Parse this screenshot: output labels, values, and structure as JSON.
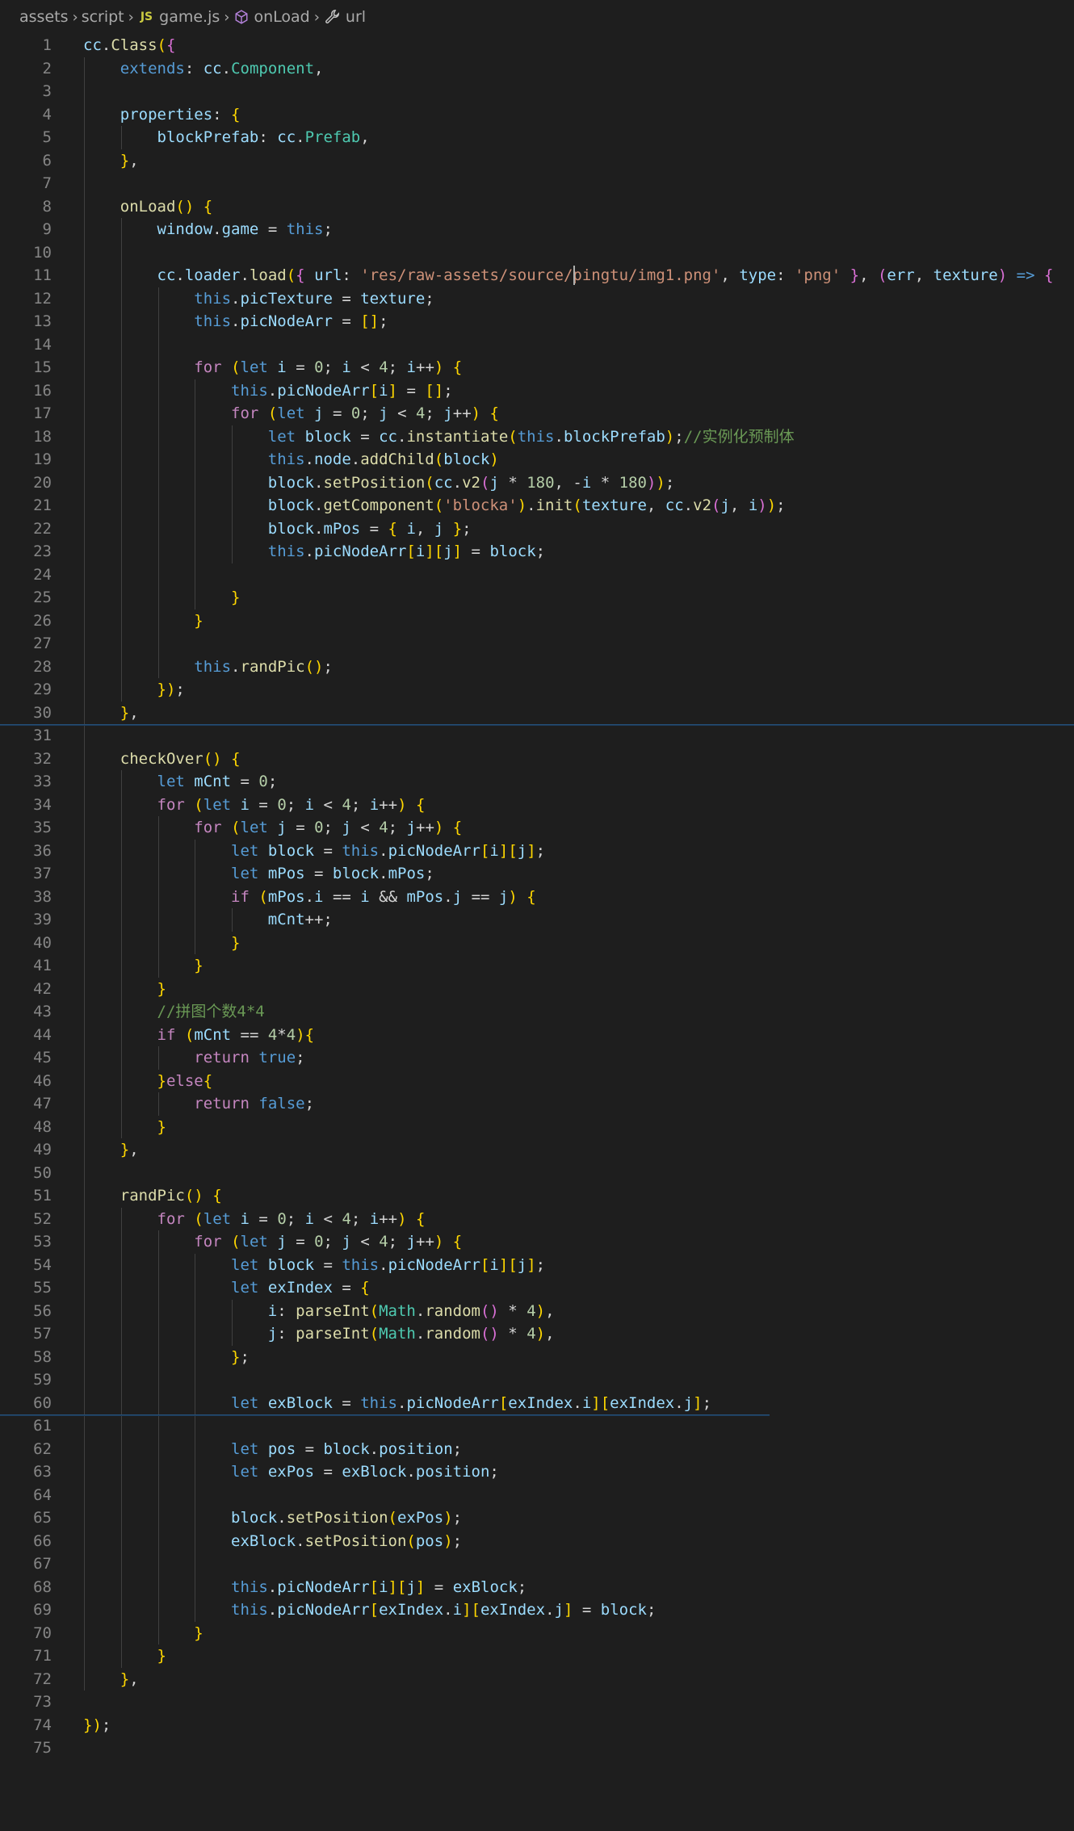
{
  "breadcrumb": {
    "items": [
      "assets",
      "script",
      "game.js",
      "onLoad",
      "url"
    ],
    "file_icon": "JS"
  },
  "editor": {
    "language": "javascript",
    "lines": [
      "cc.Class({",
      "    extends: cc.Component,",
      "",
      "    properties: {",
      "        blockPrefab: cc.Prefab,",
      "    },",
      "",
      "    onLoad() {",
      "        window.game = this;",
      "",
      "        cc.loader.load({ url: 'res/raw-assets/source/pingtu/img1.png', type: 'png' }, (err, texture) => {",
      "            this.picTexture = texture;",
      "            this.picNodeArr = [];",
      "",
      "            for (let i = 0; i < 4; i++) {",
      "                this.picNodeArr[i] = [];",
      "                for (let j = 0; j < 4; j++) {",
      "                    let block = cc.instantiate(this.blockPrefab);//实例化预制体",
      "                    this.node.addChild(block)",
      "                    block.setPosition(cc.v2(j * 180, -i * 180));",
      "                    block.getComponent('blocka').init(texture, cc.v2(j, i));",
      "                    block.mPos = { i, j };",
      "                    this.picNodeArr[i][j] = block;",
      "",
      "                }",
      "            }",
      "",
      "            this.randPic();",
      "        });",
      "    },",
      "",
      "    checkOver() {",
      "        let mCnt = 0;",
      "        for (let i = 0; i < 4; i++) {",
      "            for (let j = 0; j < 4; j++) {",
      "                let block = this.picNodeArr[i][j];",
      "                let mPos = block.mPos;",
      "                if (mPos.i == i && mPos.j == j) {",
      "                    mCnt++;",
      "                }",
      "            }",
      "        }",
      "        //拼图个数4*4",
      "        if (mCnt == 4*4){",
      "            return true;",
      "        }else{",
      "            return false;",
      "        }",
      "    },",
      "",
      "    randPic() {",
      "        for (let i = 0; i < 4; i++) {",
      "            for (let j = 0; j < 4; j++) {",
      "                let block = this.picNodeArr[i][j];",
      "                let exIndex = {",
      "                    i: parseInt(Math.random() * 4),",
      "                    j: parseInt(Math.random() * 4),",
      "                };",
      "",
      "                let exBlock = this.picNodeArr[exIndex.i][exIndex.j];",
      "",
      "                let pos = block.position;",
      "                let exPos = exBlock.position;",
      "",
      "                block.setPosition(exPos);",
      "                exBlock.setPosition(pos);",
      "",
      "                this.picNodeArr[i][j] = exBlock;",
      "                this.picNodeArr[exIndex.i][exIndex.j] = block;",
      "            }",
      "        }",
      "    },",
      "",
      "});",
      ""
    ],
    "cursor_line": 11
  },
  "colors": {
    "background": "#1e1e1e",
    "line_number": "#858585",
    "keyword": "#c586c0",
    "storage": "#569cd6",
    "function": "#dcdcaa",
    "variable": "#9cdcfe",
    "string": "#ce9178",
    "number": "#b5cea8",
    "class": "#4ec9b0",
    "comment": "#6a9955"
  }
}
